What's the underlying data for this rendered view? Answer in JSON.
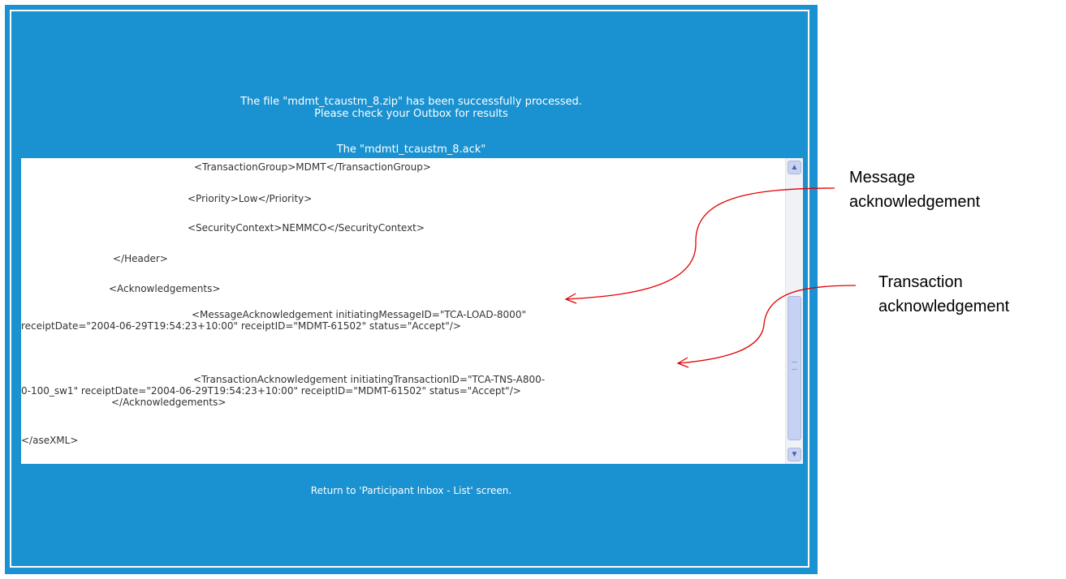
{
  "status": {
    "line1": "The file \"mdmt_tcaustm_8.zip\" has been successfully processed.",
    "line2": "Please check your Outbox for results"
  },
  "file_title": "The \"mdmtl_tcaustm_8.ack\"",
  "xml_lines": [
    "<TransactionGroup>MDMT</TransactionGroup>",
    "<Priority>Low</Priority>",
    "<SecurityContext>NEMMCO</SecurityContext>",
    "</Header>",
    "<Acknowledgements>",
    "<MessageAcknowledgement initiatingMessageID=\"TCA-LOAD-8000\"",
    "receiptDate=\"2004-06-29T19:54:23+10:00\" receiptID=\"MDMT-61502\" status=\"Accept\"/>",
    "<TransactionAcknowledgement initiatingTransactionID=\"TCA-TNS-A800-",
    "0-100_sw1\" receiptDate=\"2004-06-29T19:54:23+10:00\" receiptID=\"MDMT-61502\" status=\"Accept\"/>",
    "</Acknowledgements>",
    "</aseXML>"
  ],
  "return_link": "Return to 'Participant Inbox - List' screen.",
  "callouts": {
    "message_line1": "Message",
    "message_line2": "acknowledgement",
    "transaction_line1": "Transaction",
    "transaction_line2": "acknowledgement"
  },
  "colors": {
    "frame": "#1a91d0",
    "arrow": "#e30000"
  },
  "icons": {
    "scroll_up": "up-arrow-icon",
    "scroll_down": "down-arrow-icon",
    "scroll_grip": "grip-icon"
  }
}
